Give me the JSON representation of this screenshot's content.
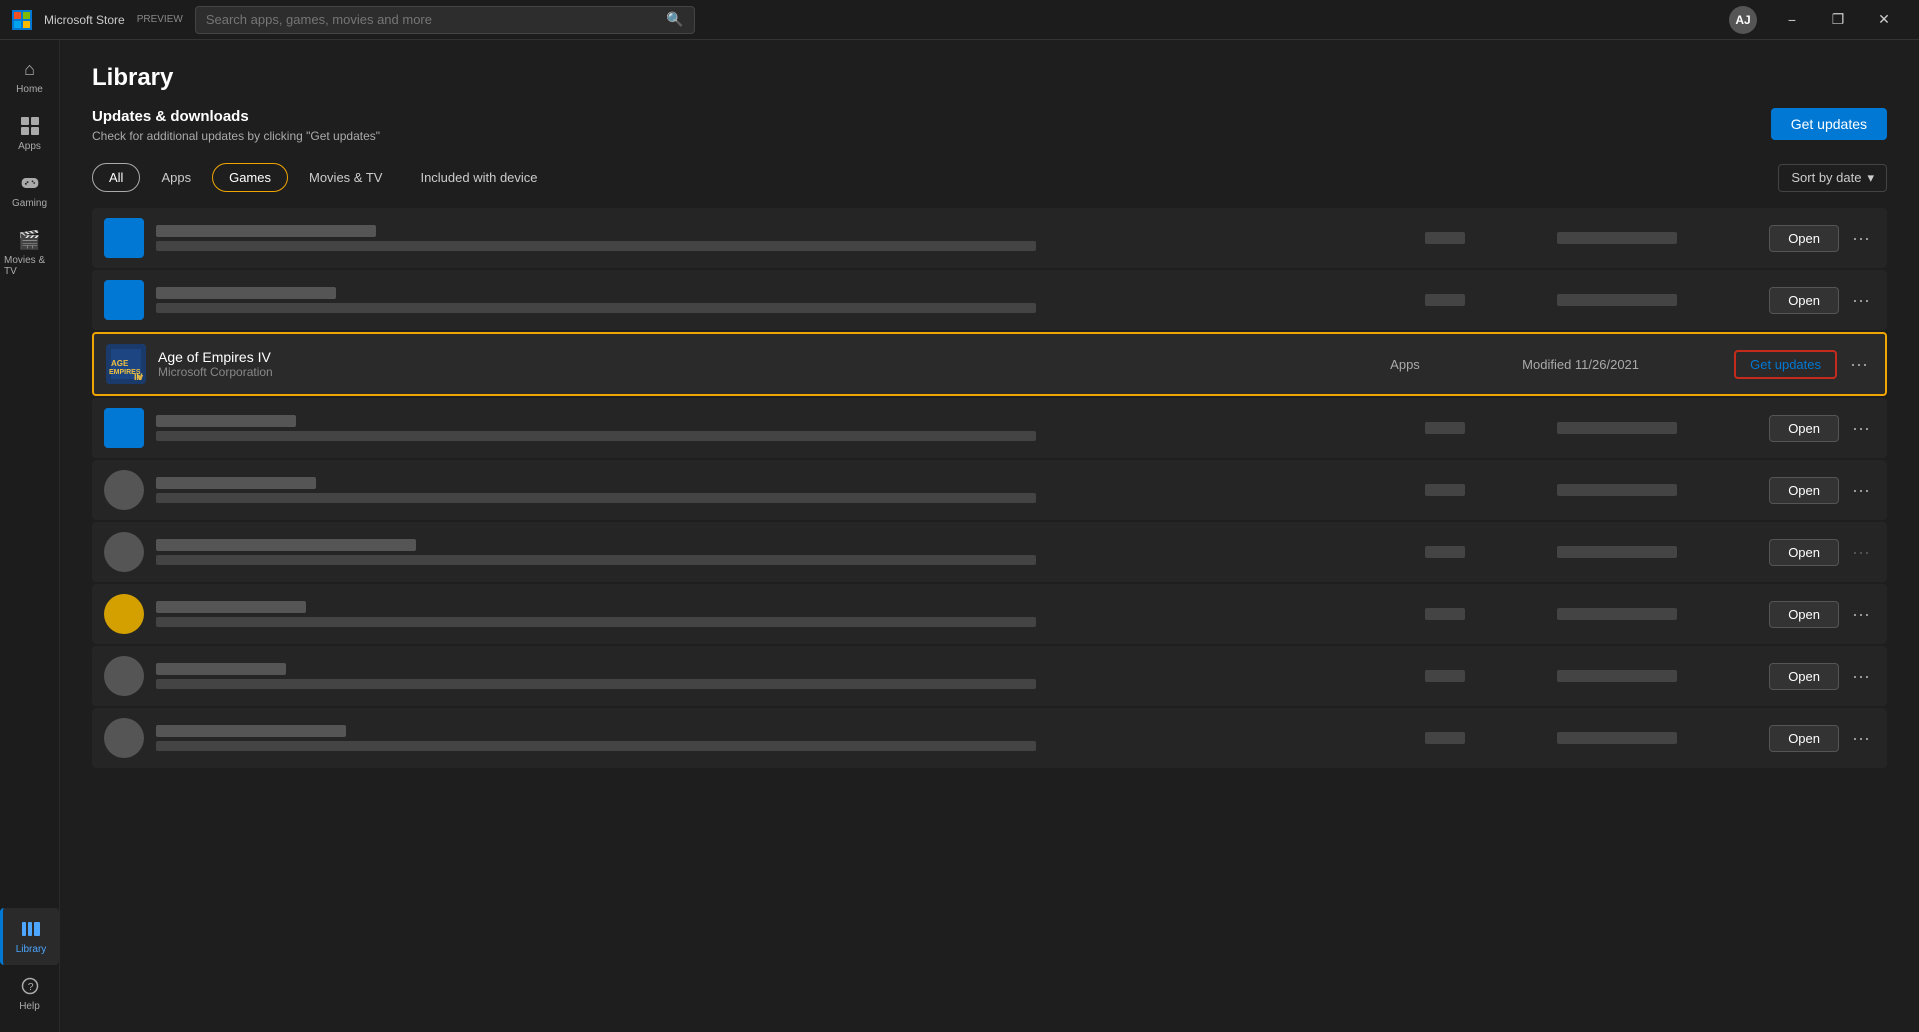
{
  "titlebar": {
    "logo": "■",
    "app_name": "Microsoft Store",
    "preview_label": "PREVIEW",
    "search_placeholder": "Search apps, games, movies and more",
    "user_initials": "AJ",
    "minimize_label": "−",
    "restore_label": "❐",
    "close_label": "✕"
  },
  "sidebar": {
    "items": [
      {
        "id": "home",
        "icon": "⌂",
        "label": "Home"
      },
      {
        "id": "apps",
        "icon": "⊞",
        "label": "Apps"
      },
      {
        "id": "gaming",
        "icon": "🎮",
        "label": "Gaming"
      },
      {
        "id": "movies",
        "icon": "🎬",
        "label": "Movies & TV"
      }
    ],
    "bottom_items": [
      {
        "id": "library",
        "icon": "▦",
        "label": "Library",
        "active": true
      },
      {
        "id": "help",
        "icon": "?",
        "label": "Help"
      }
    ]
  },
  "page": {
    "title": "Library",
    "updates_title": "Updates & downloads",
    "updates_subtitle": "Check for additional updates by clicking \"Get updates\"",
    "get_updates_btn": "Get updates"
  },
  "filters": {
    "tabs": [
      {
        "id": "all",
        "label": "All",
        "active_style": "all"
      },
      {
        "id": "apps",
        "label": "Apps",
        "active_style": "none"
      },
      {
        "id": "games",
        "label": "Games",
        "active_style": "games"
      },
      {
        "id": "movies",
        "label": "Movies & TV",
        "active_style": "none"
      },
      {
        "id": "included",
        "label": "Included with device",
        "active_style": "none"
      }
    ],
    "sort_label": "Sort by date",
    "sort_icon": "▾"
  },
  "app_list": {
    "rows": [
      {
        "id": "row1",
        "icon_type": "blue",
        "name_blurred": true,
        "type_blurred": true,
        "date_blurred": true,
        "action": "Open",
        "highlighted": false
      },
      {
        "id": "row2",
        "icon_type": "blue",
        "name_blurred": true,
        "type_blurred": true,
        "date_blurred": true,
        "action": "Open",
        "highlighted": false
      },
      {
        "id": "aoe",
        "icon_type": "aoe",
        "name": "Age of Empires IV",
        "publisher": "Microsoft Corporation",
        "type": "Apps",
        "date": "Modified 11/26/2021",
        "action": "Get updates",
        "highlighted": true,
        "get_updates_label": "Get updates"
      },
      {
        "id": "row4",
        "icon_type": "blue",
        "name_blurred": true,
        "type_blurred": true,
        "date_blurred": true,
        "action": "Open",
        "highlighted": false
      },
      {
        "id": "row5",
        "icon_type": "gray",
        "name_blurred": true,
        "type_blurred": true,
        "date_blurred": true,
        "action": "Open",
        "highlighted": false
      },
      {
        "id": "row6",
        "icon_type": "gray",
        "name_blurred": true,
        "type_blurred": true,
        "date_blurred": true,
        "action": "Open",
        "highlighted": false
      },
      {
        "id": "row7",
        "icon_type": "yellow",
        "name_blurred": true,
        "type_blurred": true,
        "date_blurred": true,
        "action": "Open",
        "highlighted": false
      },
      {
        "id": "row8",
        "icon_type": "gray",
        "name_blurred": true,
        "type_blurred": true,
        "date_blurred": true,
        "action": "Open",
        "highlighted": false
      },
      {
        "id": "row9",
        "icon_type": "gray",
        "name_blurred": true,
        "type_blurred": true,
        "date_blurred": true,
        "action": "Open",
        "highlighted": false
      }
    ]
  }
}
